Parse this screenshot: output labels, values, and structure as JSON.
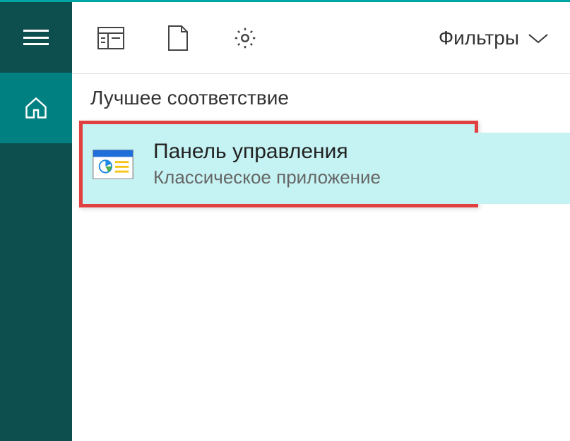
{
  "toolbar": {
    "filters_label": "Фильтры"
  },
  "section": {
    "header": "Лучшее соответствие"
  },
  "result": {
    "title": "Панель управления",
    "subtitle": "Классическое приложение"
  }
}
